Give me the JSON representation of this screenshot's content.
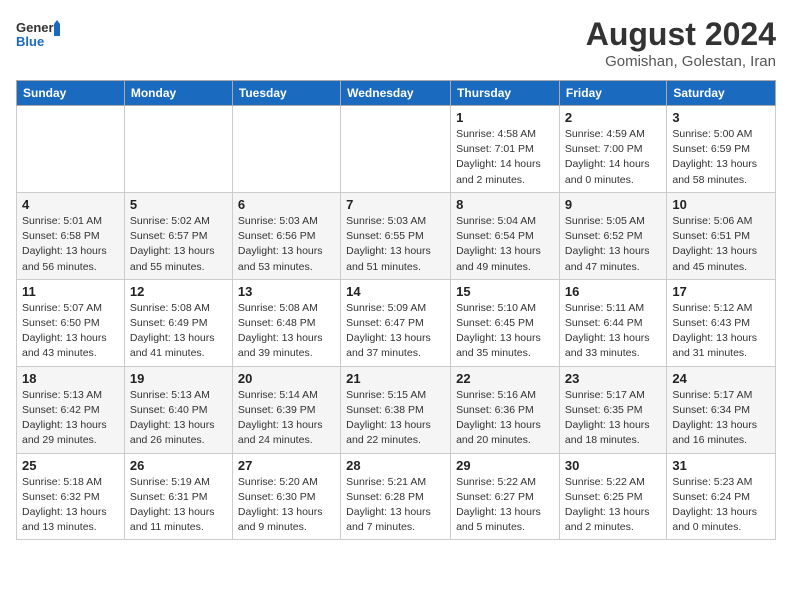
{
  "header": {
    "logo_general": "General",
    "logo_blue": "Blue",
    "title": "August 2024",
    "subtitle": "Gomishan, Golestan, Iran"
  },
  "days_of_week": [
    "Sunday",
    "Monday",
    "Tuesday",
    "Wednesday",
    "Thursday",
    "Friday",
    "Saturday"
  ],
  "weeks": [
    [
      {
        "day": "",
        "info": ""
      },
      {
        "day": "",
        "info": ""
      },
      {
        "day": "",
        "info": ""
      },
      {
        "day": "",
        "info": ""
      },
      {
        "day": "1",
        "info": "Sunrise: 4:58 AM\nSunset: 7:01 PM\nDaylight: 14 hours\nand 2 minutes."
      },
      {
        "day": "2",
        "info": "Sunrise: 4:59 AM\nSunset: 7:00 PM\nDaylight: 14 hours\nand 0 minutes."
      },
      {
        "day": "3",
        "info": "Sunrise: 5:00 AM\nSunset: 6:59 PM\nDaylight: 13 hours\nand 58 minutes."
      }
    ],
    [
      {
        "day": "4",
        "info": "Sunrise: 5:01 AM\nSunset: 6:58 PM\nDaylight: 13 hours\nand 56 minutes."
      },
      {
        "day": "5",
        "info": "Sunrise: 5:02 AM\nSunset: 6:57 PM\nDaylight: 13 hours\nand 55 minutes."
      },
      {
        "day": "6",
        "info": "Sunrise: 5:03 AM\nSunset: 6:56 PM\nDaylight: 13 hours\nand 53 minutes."
      },
      {
        "day": "7",
        "info": "Sunrise: 5:03 AM\nSunset: 6:55 PM\nDaylight: 13 hours\nand 51 minutes."
      },
      {
        "day": "8",
        "info": "Sunrise: 5:04 AM\nSunset: 6:54 PM\nDaylight: 13 hours\nand 49 minutes."
      },
      {
        "day": "9",
        "info": "Sunrise: 5:05 AM\nSunset: 6:52 PM\nDaylight: 13 hours\nand 47 minutes."
      },
      {
        "day": "10",
        "info": "Sunrise: 5:06 AM\nSunset: 6:51 PM\nDaylight: 13 hours\nand 45 minutes."
      }
    ],
    [
      {
        "day": "11",
        "info": "Sunrise: 5:07 AM\nSunset: 6:50 PM\nDaylight: 13 hours\nand 43 minutes."
      },
      {
        "day": "12",
        "info": "Sunrise: 5:08 AM\nSunset: 6:49 PM\nDaylight: 13 hours\nand 41 minutes."
      },
      {
        "day": "13",
        "info": "Sunrise: 5:08 AM\nSunset: 6:48 PM\nDaylight: 13 hours\nand 39 minutes."
      },
      {
        "day": "14",
        "info": "Sunrise: 5:09 AM\nSunset: 6:47 PM\nDaylight: 13 hours\nand 37 minutes."
      },
      {
        "day": "15",
        "info": "Sunrise: 5:10 AM\nSunset: 6:45 PM\nDaylight: 13 hours\nand 35 minutes."
      },
      {
        "day": "16",
        "info": "Sunrise: 5:11 AM\nSunset: 6:44 PM\nDaylight: 13 hours\nand 33 minutes."
      },
      {
        "day": "17",
        "info": "Sunrise: 5:12 AM\nSunset: 6:43 PM\nDaylight: 13 hours\nand 31 minutes."
      }
    ],
    [
      {
        "day": "18",
        "info": "Sunrise: 5:13 AM\nSunset: 6:42 PM\nDaylight: 13 hours\nand 29 minutes."
      },
      {
        "day": "19",
        "info": "Sunrise: 5:13 AM\nSunset: 6:40 PM\nDaylight: 13 hours\nand 26 minutes."
      },
      {
        "day": "20",
        "info": "Sunrise: 5:14 AM\nSunset: 6:39 PM\nDaylight: 13 hours\nand 24 minutes."
      },
      {
        "day": "21",
        "info": "Sunrise: 5:15 AM\nSunset: 6:38 PM\nDaylight: 13 hours\nand 22 minutes."
      },
      {
        "day": "22",
        "info": "Sunrise: 5:16 AM\nSunset: 6:36 PM\nDaylight: 13 hours\nand 20 minutes."
      },
      {
        "day": "23",
        "info": "Sunrise: 5:17 AM\nSunset: 6:35 PM\nDaylight: 13 hours\nand 18 minutes."
      },
      {
        "day": "24",
        "info": "Sunrise: 5:17 AM\nSunset: 6:34 PM\nDaylight: 13 hours\nand 16 minutes."
      }
    ],
    [
      {
        "day": "25",
        "info": "Sunrise: 5:18 AM\nSunset: 6:32 PM\nDaylight: 13 hours\nand 13 minutes."
      },
      {
        "day": "26",
        "info": "Sunrise: 5:19 AM\nSunset: 6:31 PM\nDaylight: 13 hours\nand 11 minutes."
      },
      {
        "day": "27",
        "info": "Sunrise: 5:20 AM\nSunset: 6:30 PM\nDaylight: 13 hours\nand 9 minutes."
      },
      {
        "day": "28",
        "info": "Sunrise: 5:21 AM\nSunset: 6:28 PM\nDaylight: 13 hours\nand 7 minutes."
      },
      {
        "day": "29",
        "info": "Sunrise: 5:22 AM\nSunset: 6:27 PM\nDaylight: 13 hours\nand 5 minutes."
      },
      {
        "day": "30",
        "info": "Sunrise: 5:22 AM\nSunset: 6:25 PM\nDaylight: 13 hours\nand 2 minutes."
      },
      {
        "day": "31",
        "info": "Sunrise: 5:23 AM\nSunset: 6:24 PM\nDaylight: 13 hours\nand 0 minutes."
      }
    ]
  ]
}
